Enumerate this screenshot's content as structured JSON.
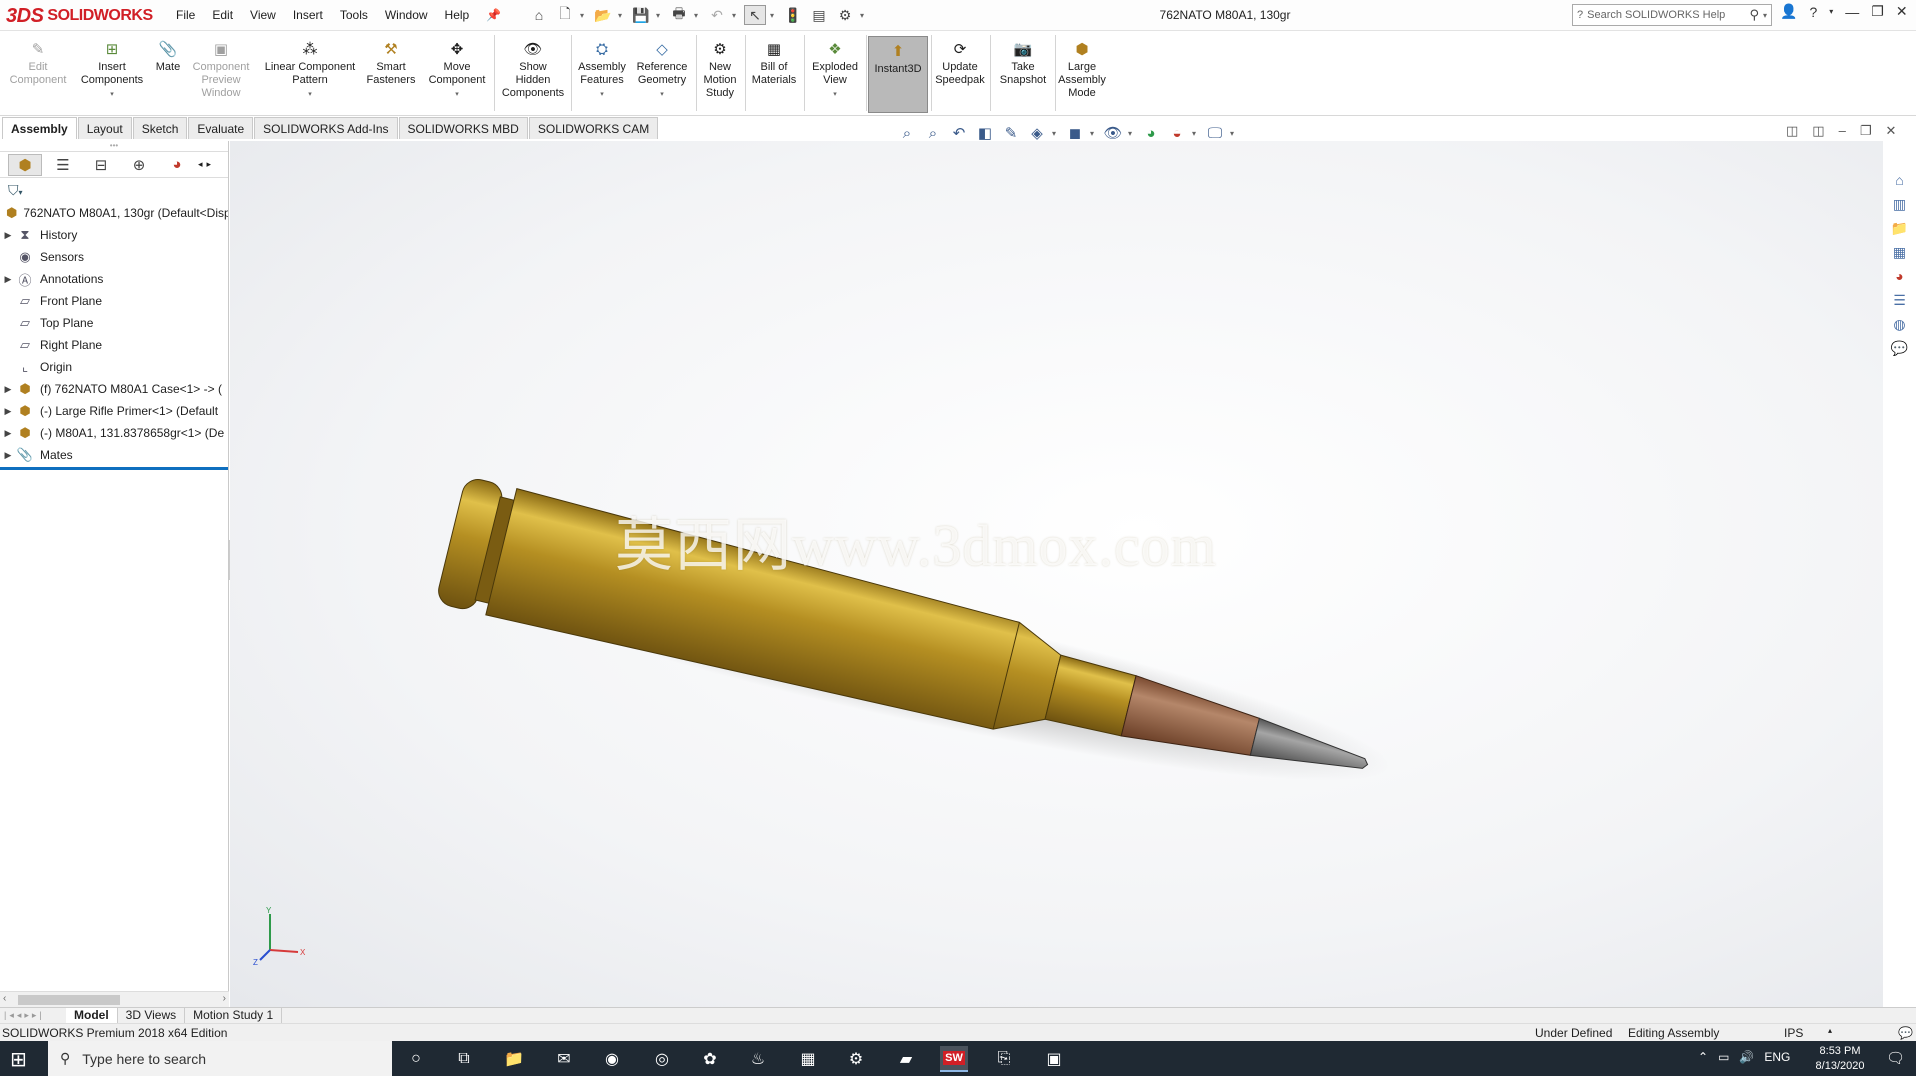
{
  "app": {
    "brand_mark": "3DS",
    "brand": "SOLIDWORKS",
    "title": "762NATO M80A1, 130gr"
  },
  "menu": [
    "File",
    "Edit",
    "View",
    "Insert",
    "Tools",
    "Window",
    "Help"
  ],
  "search": {
    "placeholder": "Search SOLIDWORKS Help"
  },
  "ribbon": {
    "edit_component": [
      "Edit",
      "Component"
    ],
    "insert_components": [
      "Insert",
      "Components"
    ],
    "mate": [
      "Mate"
    ],
    "component_preview": [
      "Component",
      "Preview",
      "Window"
    ],
    "linear_pattern": [
      "Linear Component",
      "Pattern"
    ],
    "smart_fasteners": [
      "Smart",
      "Fasteners"
    ],
    "move_component": [
      "Move",
      "Component"
    ],
    "show_hidden": [
      "Show",
      "Hidden",
      "Components"
    ],
    "assembly_features": [
      "Assembly",
      "Features"
    ],
    "reference_geometry": [
      "Reference",
      "Geometry"
    ],
    "new_motion_study": [
      "New",
      "Motion",
      "Study"
    ],
    "bill_of_materials": [
      "Bill of",
      "Materials"
    ],
    "exploded_view": [
      "Exploded",
      "View"
    ],
    "instant3d": [
      "Instant3D"
    ],
    "update_speedpak": [
      "Update",
      "Speedpak"
    ],
    "take_snapshot": [
      "Take",
      "Snapshot"
    ],
    "large_assembly": [
      "Large",
      "Assembly",
      "Mode"
    ]
  },
  "tabs": [
    "Assembly",
    "Layout",
    "Sketch",
    "Evaluate",
    "SOLIDWORKS Add-Ins",
    "SOLIDWORKS MBD",
    "SOLIDWORKS CAM"
  ],
  "tree": {
    "root": "762NATO M80A1, 130gr  (Default<Disp",
    "items": [
      "History",
      "Sensors",
      "Annotations",
      "Front Plane",
      "Top Plane",
      "Right Plane",
      "Origin",
      "(f) 762NATO M80A1 Case<1> -> (",
      "(-) Large Rifle Primer<1> (Default",
      "(-) M80A1, 131.8378658gr<1> (De",
      "Mates"
    ]
  },
  "watermark": "莫西网www.3dmox.com",
  "triad": {
    "y": "Y",
    "x": "X",
    "z": "Z"
  },
  "bottom_tabs": [
    "Model",
    "3D Views",
    "Motion Study 1"
  ],
  "status": {
    "edition": "SOLIDWORKS Premium 2018 x64 Edition",
    "state": "Under Defined",
    "mode": "Editing Assembly",
    "units": "IPS"
  },
  "taskbar": {
    "search_placeholder": "Type here to search",
    "sw_badge": "SW",
    "tray_lang": "ENG",
    "time": "8:53 PM",
    "date": "8/13/2020"
  },
  "colors": {
    "brand_red": "#d11f26",
    "brass": "#c9a02c",
    "copper": "#8c5a3c",
    "tip": "#6f6f6f",
    "taskbar": "#1f2933"
  }
}
